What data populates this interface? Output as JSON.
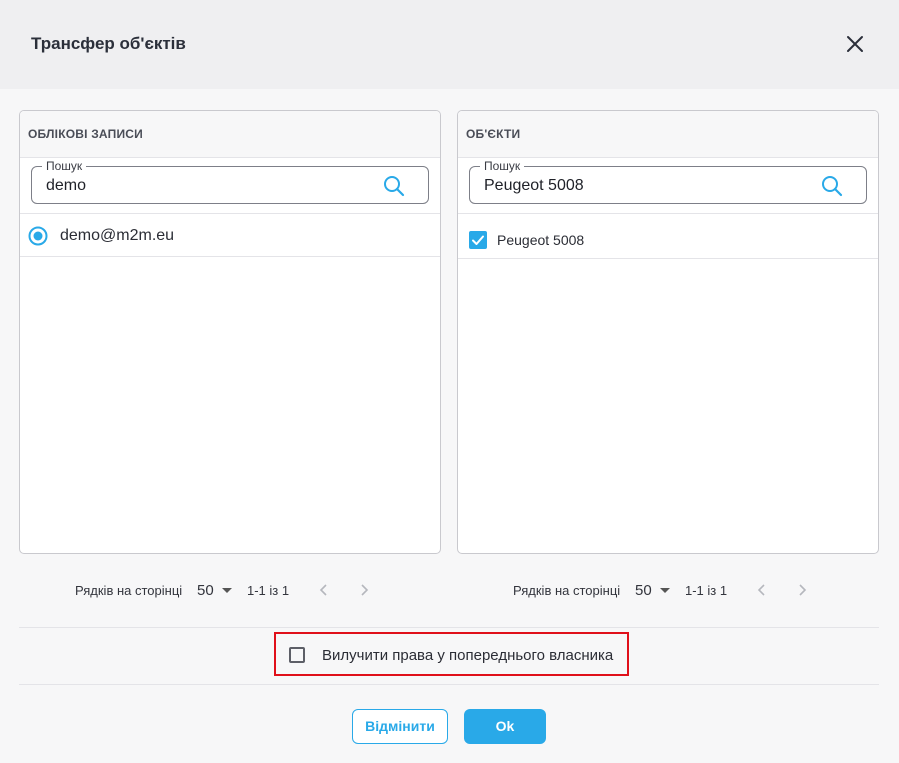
{
  "dialog": {
    "title": "Трансфер об'єктів"
  },
  "accounts": {
    "header": "ОБЛІКОВІ ЗАПИСИ",
    "search_label": "Пошук",
    "search_value": "demo",
    "items": [
      {
        "label": "demo@m2m.eu",
        "selected": true
      }
    ],
    "pager": {
      "rows_label": "Рядків на сторінці",
      "rows_value": "50",
      "range": "1-1 із 1"
    }
  },
  "objects": {
    "header": "ОБ'ЄКТИ",
    "search_label": "Пошук",
    "search_value": "Peugeot 5008",
    "items": [
      {
        "label": "Peugeot 5008",
        "checked": true
      }
    ],
    "pager": {
      "rows_label": "Рядків на сторінці",
      "rows_value": "50",
      "range": "1-1 із 1"
    }
  },
  "option": {
    "label": "Вилучити права у попереднього власника",
    "checked": false
  },
  "actions": {
    "cancel_label": "Відмінити",
    "ok_label": "Ok"
  },
  "colors": {
    "accent": "#29a9e8",
    "highlight": "#e0101a"
  }
}
